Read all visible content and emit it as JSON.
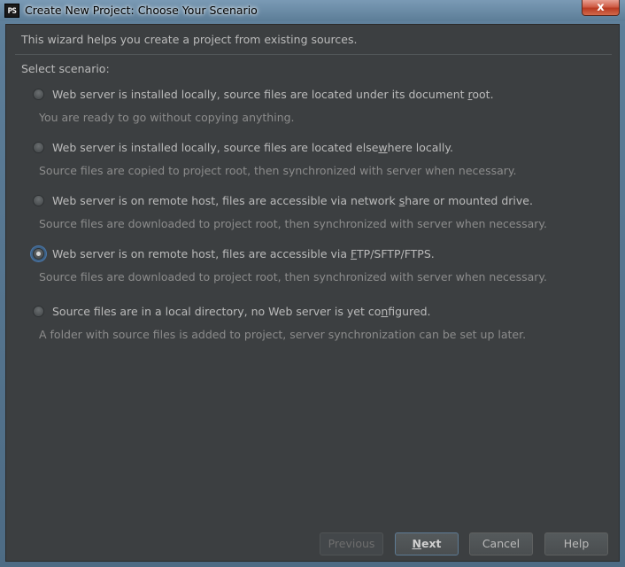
{
  "window": {
    "app_icon": "PS",
    "title": "Create New Project: Choose Your Scenario",
    "close_glyph": "x"
  },
  "intro": "This wizard helps you create a project from existing sources.",
  "scenario_label": "Select scenario:",
  "options": [
    {
      "label_pre": "Web server is installed locally, source files are located under its document ",
      "label_mn": "r",
      "label_post": "oot.",
      "description": "You are ready to go without copying anything.",
      "selected": false
    },
    {
      "label_pre": "Web server is installed locally, source files are located else",
      "label_mn": "w",
      "label_post": "here locally.",
      "description": "Source files are copied to project root, then synchronized with server when necessary.",
      "selected": false
    },
    {
      "label_pre": "Web server is on remote host, files are accessible via network ",
      "label_mn": "s",
      "label_post": "hare or mounted drive.",
      "description": "Source files are downloaded to project root, then synchronized with server when necessary.",
      "selected": false
    },
    {
      "label_pre": "Web server is on remote host, files are accessible via ",
      "label_mn": "F",
      "label_post": "TP/SFTP/FTPS.",
      "description": "Source files are downloaded to project root, then synchronized with server when necessary.",
      "selected": true
    },
    {
      "label_pre": "Source files are in a local directory, no Web server is yet co",
      "label_mn": "n",
      "label_post": "figured.",
      "description": "A folder with source files is added to project, server synchronization can be set up later.",
      "selected": false
    }
  ],
  "buttons": {
    "previous": "Previous",
    "next_mn": "N",
    "next_rest": "ext",
    "cancel": "Cancel",
    "help": "Help"
  }
}
